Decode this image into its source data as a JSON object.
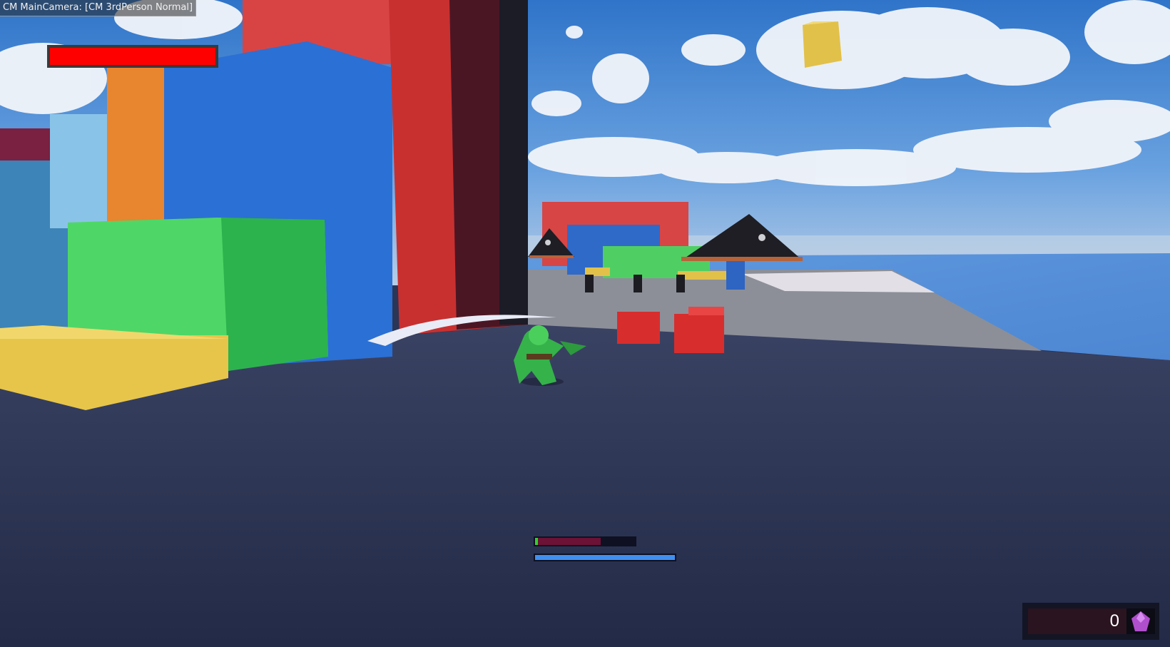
{
  "debug": {
    "camera_label": "CM MainCamera: [CM 3rdPerson Normal]"
  },
  "hud": {
    "boss_health": {
      "fraction": 1.0,
      "color": "#ff0000"
    },
    "player_health": {
      "fraction": 0.66,
      "color": "#6b1236",
      "accent": "#32d12f"
    },
    "player_stamina": {
      "fraction": 1.0,
      "color": "#3f8ff0"
    },
    "gem_count": "0",
    "gem_icon": "purple-crystal-icon"
  }
}
